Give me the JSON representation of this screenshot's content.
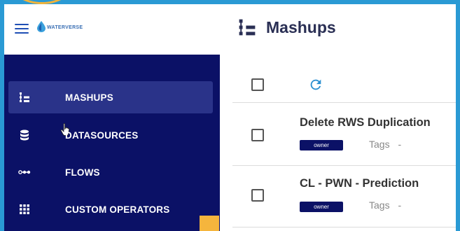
{
  "app": {
    "logo_text": "WATERVERSE",
    "brand_color": "#0b1166",
    "accent_color": "#2a9ad4"
  },
  "sidebar": {
    "items": [
      {
        "label": "MASHUPS",
        "icon": "mashups-icon",
        "active": true
      },
      {
        "label": "DATASOURCES",
        "icon": "database-icon",
        "active": false
      },
      {
        "label": "FLOWS",
        "icon": "flows-icon",
        "active": false
      },
      {
        "label": "CUSTOM OPERATORS",
        "icon": "grid-icon",
        "active": false
      }
    ]
  },
  "main": {
    "title": "Mashups",
    "title_icon": "mashups-icon",
    "toolbar": {
      "refresh_icon": "refresh-icon"
    },
    "rows": [
      {
        "title": "Delete RWS Duplication",
        "badge": "owner",
        "tags_label": "Tags",
        "tags_value": "-"
      },
      {
        "title": "CL - PWN - Prediction",
        "badge": "owner",
        "tags_label": "Tags",
        "tags_value": "-"
      }
    ]
  }
}
